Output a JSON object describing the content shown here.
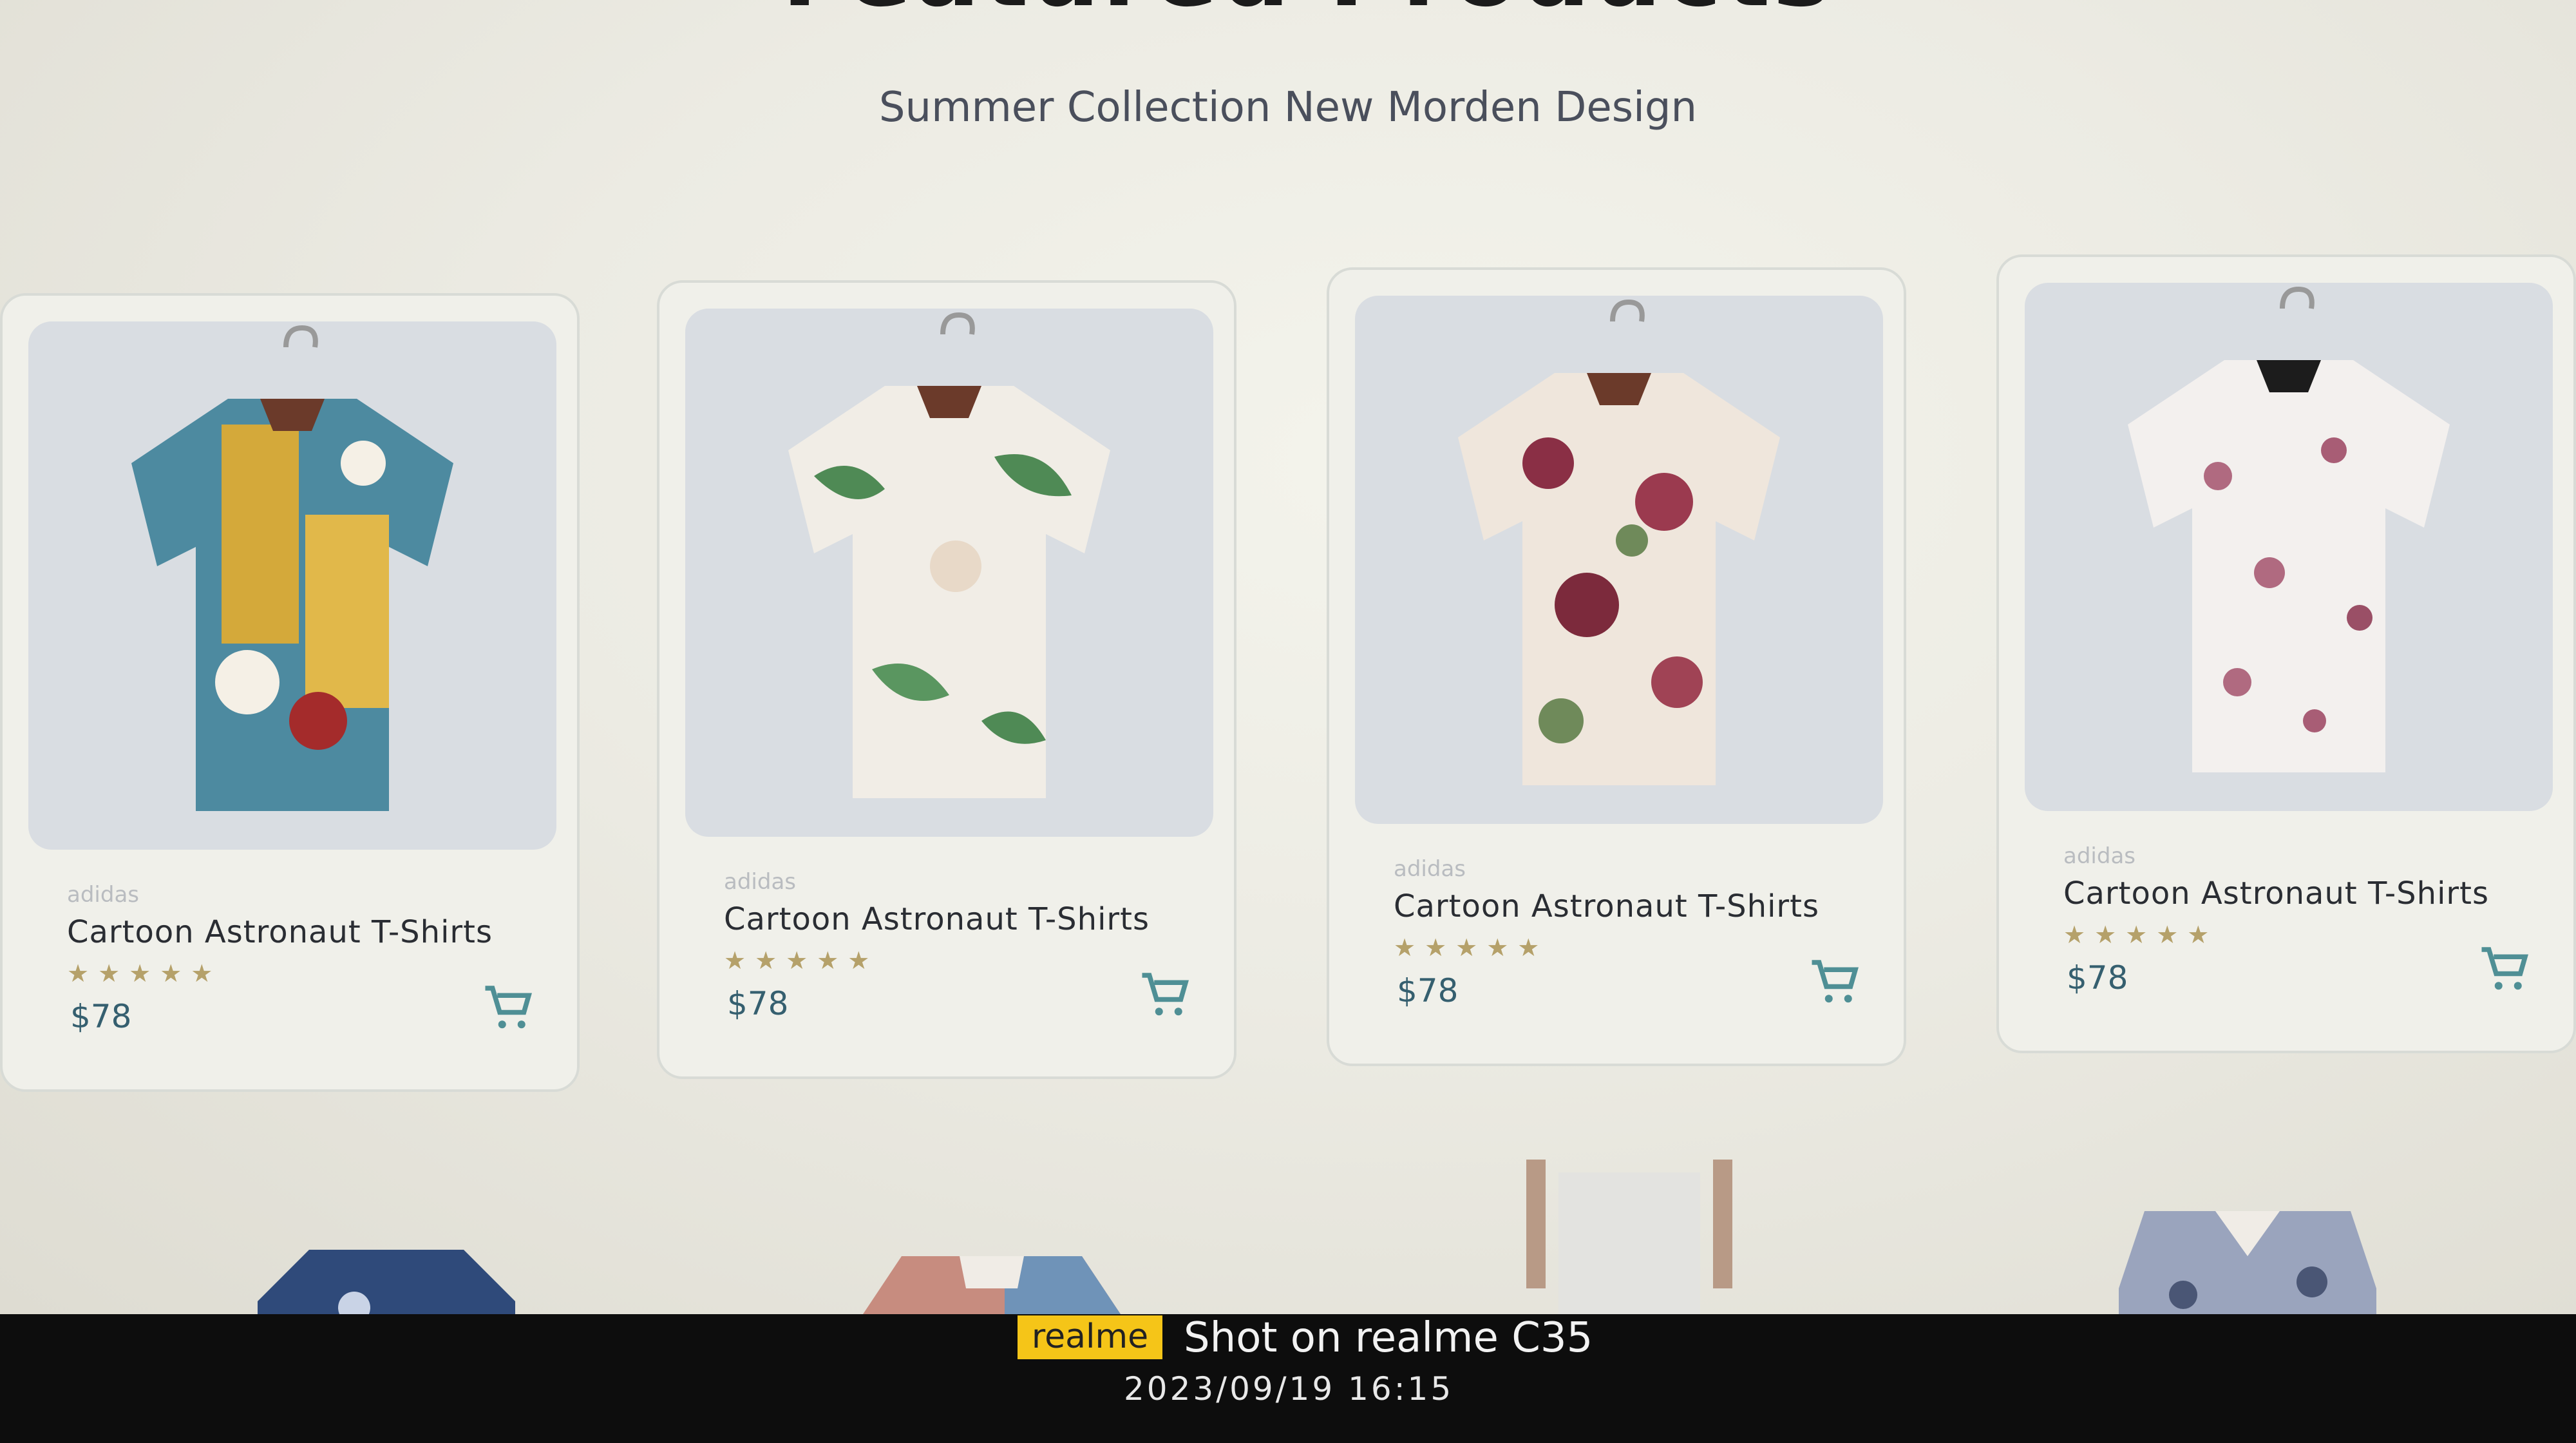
{
  "section": {
    "heading": "Featured Products",
    "subtitle": "Summer Collection New Morden Design"
  },
  "products": [
    {
      "brand": "adidas",
      "name": "Cartoon Astronaut T-Shirts",
      "rating": "★★★★★",
      "price": "$78",
      "image_icon": "shirt-image",
      "cart_icon": "cart-icon"
    },
    {
      "brand": "adidas",
      "name": "Cartoon Astronaut T-Shirts",
      "rating": "★★★★★",
      "price": "$78",
      "image_icon": "shirt-image",
      "cart_icon": "cart-icon"
    },
    {
      "brand": "adidas",
      "name": "Cartoon Astronaut T-Shirts",
      "rating": "★★★★★",
      "price": "$78",
      "image_icon": "shirt-image",
      "cart_icon": "cart-icon"
    },
    {
      "brand": "adidas",
      "name": "Cartoon Astronaut T-Shirts",
      "rating": "★★★★★",
      "price": "$78",
      "image_icon": "shirt-image",
      "cart_icon": "cart-icon"
    }
  ],
  "watermark": {
    "brand": "realme",
    "text": "Shot on realme C35",
    "datetime": "2023/09/19  16:15"
  },
  "colors": {
    "accent_price": "#355f6f",
    "star": "#b5a16a",
    "watermark_badge": "#f5c518"
  }
}
